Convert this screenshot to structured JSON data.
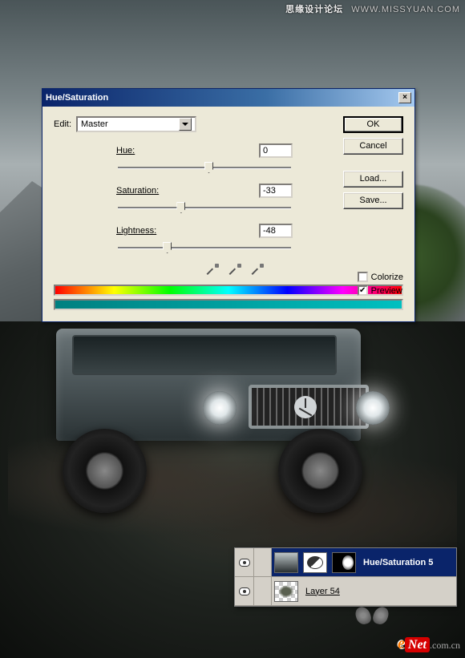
{
  "watermark_top": {
    "cn": "思缘设计论坛",
    "en": "WWW.MISSYUAN.COM"
  },
  "dialog": {
    "title": "Hue/Saturation",
    "edit_label": "Edit:",
    "edit_value": "Master",
    "sliders": {
      "hue": {
        "label": "Hue:",
        "value": "0",
        "pos": 50
      },
      "saturation": {
        "label": "Saturation:",
        "value": "-33",
        "pos": 34
      },
      "lightness": {
        "label": "Lightness:",
        "value": "-48",
        "pos": 26
      }
    },
    "buttons": {
      "ok": "OK",
      "cancel": "Cancel",
      "load": "Load...",
      "save": "Save..."
    },
    "colorize": {
      "label": "Colorize",
      "checked": false
    },
    "preview": {
      "label": "Preview",
      "checked": true
    }
  },
  "layers": {
    "row1": {
      "name": "Hue/Saturation 5"
    },
    "row2": {
      "name": "Layer 54"
    }
  },
  "watermark_bottom": {
    "e": "e",
    "net": "Net",
    "com": ".com.cn"
  }
}
